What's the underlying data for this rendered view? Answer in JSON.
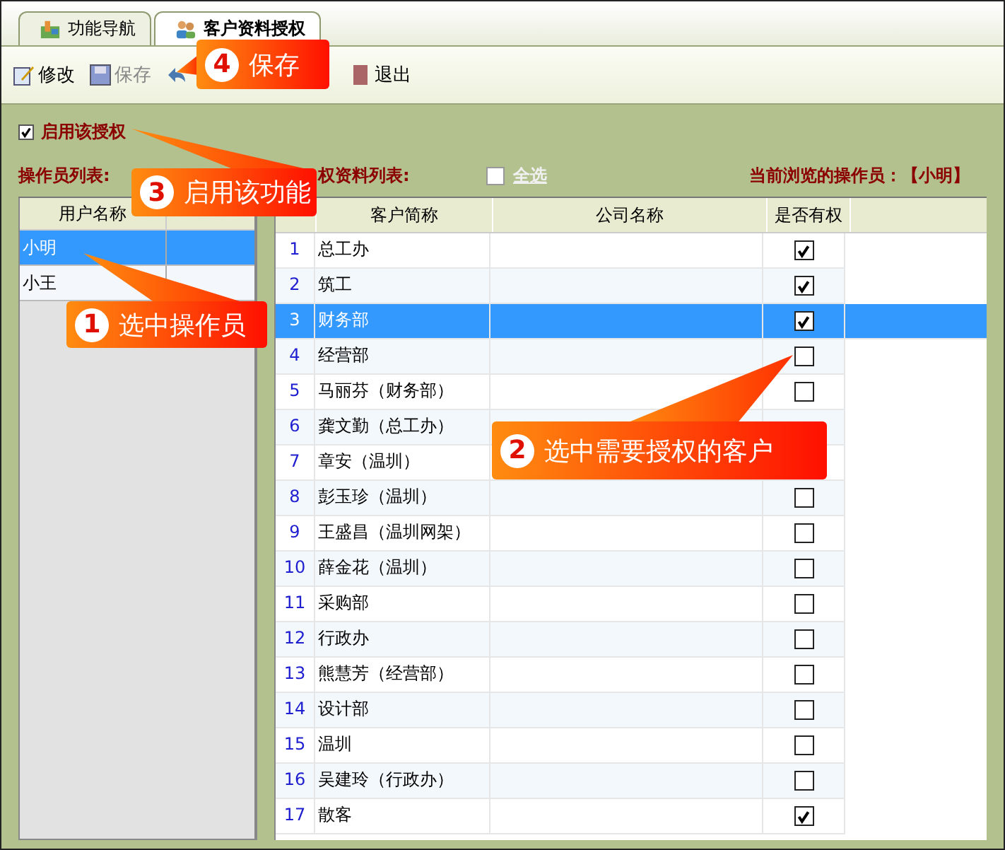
{
  "tabs": [
    {
      "label": "功能导航",
      "selected": false
    },
    {
      "label": "客户资料授权",
      "selected": true
    }
  ],
  "toolbar": [
    {
      "label": "修改",
      "disabled": false
    },
    {
      "label": "保存",
      "disabled": true
    },
    {
      "label": "退出",
      "disabled": false
    }
  ],
  "enable": {
    "label": "启用该授权",
    "checked": true
  },
  "operator_list": {
    "title": "操作员列表:",
    "columns": [
      "用户名称"
    ],
    "rows": [
      {
        "name": "小明",
        "selected": true
      },
      {
        "name": "小王",
        "selected": false
      }
    ]
  },
  "customer_list": {
    "title": "权资料列表:",
    "select_all": {
      "label": "全选",
      "checked": false,
      "disabled": true
    },
    "current_operator": "当前浏览的操作员：【小明】",
    "columns": [
      "客户简称",
      "公司名称",
      "是否有权"
    ],
    "rows": [
      {
        "no": "1",
        "name": "总工办",
        "selected": false,
        "authorized": true
      },
      {
        "no": "2",
        "name": "筑工",
        "selected": false,
        "authorized": true
      },
      {
        "no": "3",
        "name": "财务部",
        "selected": true,
        "authorized": true
      },
      {
        "no": "4",
        "name": "经营部",
        "selected": false,
        "authorized": false
      },
      {
        "no": "5",
        "name": "马丽芬（财务部）",
        "selected": false,
        "authorized": false
      },
      {
        "no": "6",
        "name": "龚文勤（总工办）",
        "selected": false
      },
      {
        "no": "7",
        "name": "章安（温圳）",
        "selected": false
      },
      {
        "no": "8",
        "name": "彭玉珍（温圳）",
        "selected": false,
        "authorized": false
      },
      {
        "no": "9",
        "name": "王盛昌（温圳网架）",
        "selected": false,
        "authorized": false
      },
      {
        "no": "10",
        "name": "薛金花（温圳）",
        "selected": false,
        "authorized": false
      },
      {
        "no": "11",
        "name": "采购部",
        "selected": false,
        "authorized": false
      },
      {
        "no": "12",
        "name": "行政办",
        "selected": false,
        "authorized": false
      },
      {
        "no": "13",
        "name": "熊慧芳（经营部）",
        "selected": false,
        "authorized": false
      },
      {
        "no": "14",
        "name": "设计部",
        "selected": false,
        "authorized": false
      },
      {
        "no": "15",
        "name": "温圳",
        "selected": false,
        "authorized": false
      },
      {
        "no": "16",
        "name": "吴建玲（行政办）",
        "selected": false,
        "authorized": false
      },
      {
        "no": "17",
        "name": "散客",
        "selected": false,
        "authorized": true
      }
    ]
  },
  "callouts": [
    {
      "number": "4",
      "text": "保存"
    },
    {
      "number": "3",
      "text": "启用该功能"
    },
    {
      "number": "1",
      "text": "选中操作员"
    },
    {
      "number": "2",
      "text": "选中需要授权的客户"
    }
  ]
}
